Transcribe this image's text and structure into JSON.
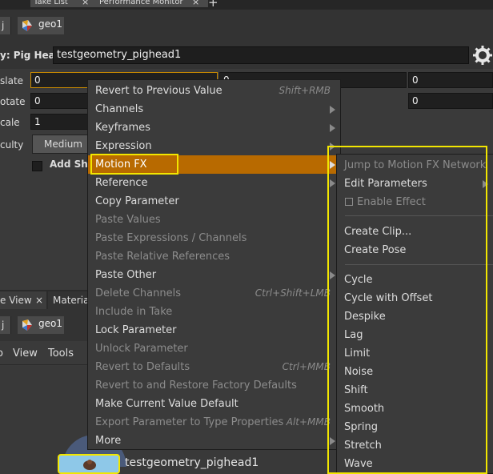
{
  "top_tabs": {
    "tab1": "Take List",
    "tab2": "Performance Monitor",
    "close": "×",
    "add": "+"
  },
  "path_bar1": {
    "prefix": "j",
    "node": "geo1"
  },
  "param_header": {
    "label": "y: Pig Head",
    "value": "testgeometry_pighead1"
  },
  "params": {
    "translate": {
      "label": "slate",
      "x": "0",
      "y": "0",
      "z": "0"
    },
    "rotate": {
      "label": "otate",
      "x": "0",
      "z": "0"
    },
    "scale": {
      "label": "cale",
      "x": "1"
    },
    "difficulty": {
      "label": "culty",
      "value": "Medium"
    },
    "add_shader": {
      "label": "Add Sha"
    }
  },
  "pane_tabs": {
    "tab1": "e View",
    "tab1_close": "×",
    "tab2": "Material"
  },
  "path_bar2": {
    "prefix": "j",
    "node": "geo1"
  },
  "network_menu": {
    "view": "View",
    "tools": "Tools"
  },
  "node": {
    "name": "testgeometry_pighead1"
  },
  "context_menu": {
    "items": [
      {
        "label": "Revert to Previous Value",
        "shortcut": "Shift+RMB",
        "disabled": false
      },
      {
        "label": "Channels",
        "submenu": true
      },
      {
        "label": "Keyframes",
        "submenu": true
      },
      {
        "label": "Expression",
        "submenu": true
      },
      {
        "label": "Motion FX",
        "submenu": true,
        "highlighted": true
      },
      {
        "label": "Reference",
        "submenu": true
      },
      {
        "label": "Copy Parameter"
      },
      {
        "label": "Paste Values",
        "disabled": true
      },
      {
        "label": "Paste Expressions / Channels",
        "disabled": true
      },
      {
        "label": "Paste Relative References",
        "disabled": true
      },
      {
        "label": "Paste Other",
        "submenu": true
      },
      {
        "label": "Delete Channels",
        "shortcut": "Ctrl+Shift+LMB",
        "disabled": true
      },
      {
        "label": "Include in Take",
        "disabled": true
      },
      {
        "label": "Lock Parameter"
      },
      {
        "label": "Unlock Parameter",
        "disabled": true
      },
      {
        "label": "Revert to Defaults",
        "shortcut": "Ctrl+MMB",
        "disabled": true
      },
      {
        "label": "Revert to and Restore Factory Defaults",
        "disabled": true
      },
      {
        "label": "Make Current Value Default"
      },
      {
        "label": "Export Parameter to Type Properties",
        "shortcut": "Alt+MMB",
        "disabled": true
      },
      {
        "label": "More",
        "submenu": true
      }
    ]
  },
  "motion_fx_menu": {
    "jump": "Jump to Motion FX Network",
    "edit": "Edit Parameters",
    "enable": "Enable Effect",
    "create_clip": "Create Clip...",
    "create_pose": "Create Pose",
    "effects": [
      "Cycle",
      "Cycle with Offset",
      "Despike",
      "Lag",
      "Limit",
      "Noise",
      "Shift",
      "Smooth",
      "Spring",
      "Stretch",
      "Wave"
    ]
  },
  "colors": {
    "highlight": "#b86a00",
    "annotation": "#f2e600",
    "menu_bg": "#3b3b3b",
    "panel_bg": "#3a3a3a"
  }
}
